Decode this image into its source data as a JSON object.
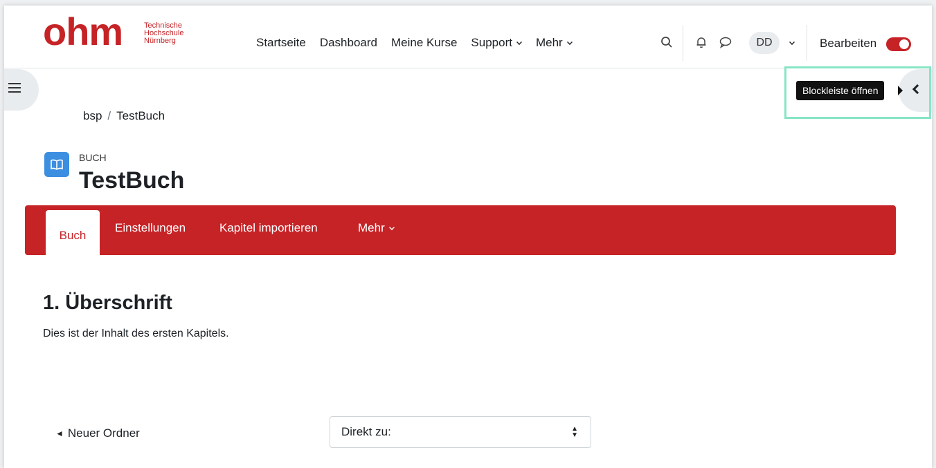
{
  "logo": {
    "word": "ohm",
    "sub_line1": "Technische",
    "sub_line2": "Hochschule",
    "sub_line3": "Nürnberg",
    "color": "#c62327"
  },
  "navbar": {
    "links": [
      {
        "label": "Startseite"
      },
      {
        "label": "Dashboard"
      },
      {
        "label": "Meine Kurse"
      },
      {
        "label": "Support"
      },
      {
        "label": "Mehr"
      }
    ],
    "search_icon": "search-icon",
    "bell_icon": "bell-icon",
    "chat_icon": "chat-icon",
    "user_initials": "DD",
    "edit_label": "Bearbeiten",
    "edit_mode_on": true
  },
  "drawer": {
    "left_icon": "list-icon",
    "right_icon": "chevron-left-icon",
    "tooltip": "Blockleiste öffnen"
  },
  "breadcrumb": {
    "items": [
      "bsp",
      "TestBuch"
    ],
    "separator": "/"
  },
  "header": {
    "activity_icon": "book-icon",
    "activity_type": "BUCH",
    "title": "TestBuch",
    "icon_color": "#3b8ee0"
  },
  "secondary_nav": {
    "tabs": [
      {
        "label": "Buch",
        "active": true
      },
      {
        "label": "Einstellungen"
      },
      {
        "label": "Kapitel importieren"
      },
      {
        "label": "Mehr"
      }
    ],
    "color": "#c62327"
  },
  "content": {
    "chapter_title": "1. Überschrift",
    "chapter_text": "Dies ist der Inhalt des ersten Kapitels."
  },
  "footer_nav": {
    "prev_label": "Neuer Ordner",
    "jump_selected": "Direkt zu:"
  },
  "colors": {
    "highlight": "#86e5c5"
  }
}
